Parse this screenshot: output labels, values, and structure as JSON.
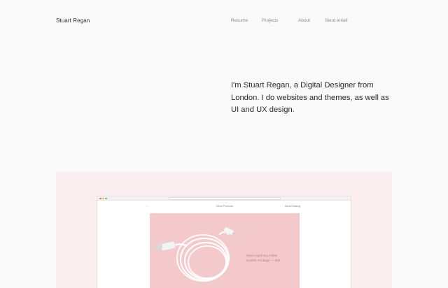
{
  "site": {
    "title": "Stuart Regan"
  },
  "nav": {
    "items": [
      {
        "label": "Resume"
      },
      {
        "label": "Projects"
      },
      {
        "label": "About"
      },
      {
        "label": "Send email"
      }
    ]
  },
  "intro": {
    "text": "I'm Stuart Regan, a Digital Designer from London. I do websites and themes, as well as UI and UX design."
  },
  "showcase": {
    "browser": {
      "back_glyph": "‹",
      "center_label": "Neue Products",
      "right_label": "Neue/Catalog"
    },
    "product": {
      "caption_line1": "Neue Lightning Cable",
      "caption_line2": "Double Package — $35"
    }
  },
  "colors": {
    "page_bg": "#f9f9f9",
    "showcase_bg": "#fbeef0",
    "product_bg": "#f4c9cc",
    "caption": "#b88288"
  }
}
